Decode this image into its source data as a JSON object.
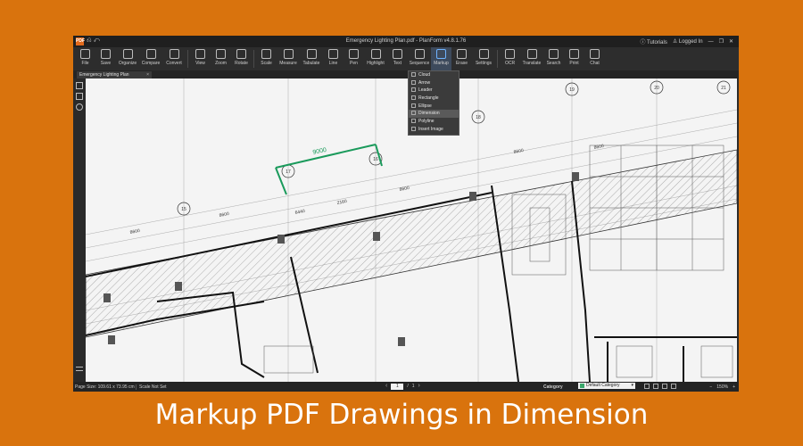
{
  "titlebar": {
    "logo": "PDF",
    "title": "Emergency Lighting Plan.pdf - PlanForm v4.8.1.76",
    "tutorials": "Tutorials",
    "logged_in": "Logged In"
  },
  "toolbar": {
    "items": [
      {
        "label": "File",
        "icon": "folder-icon"
      },
      {
        "label": "Save",
        "icon": "save-icon"
      },
      {
        "label": "Organize",
        "icon": "organize-icon"
      },
      {
        "label": "Compare",
        "icon": "compare-icon"
      },
      {
        "label": "Convert",
        "icon": "convert-icon"
      },
      {
        "label": "View",
        "icon": "view-icon"
      },
      {
        "label": "Zoom",
        "icon": "zoom-icon"
      },
      {
        "label": "Rotate",
        "icon": "rotate-icon"
      },
      {
        "label": "Scale",
        "icon": "scale-icon"
      },
      {
        "label": "Measure",
        "icon": "measure-icon"
      },
      {
        "label": "Tabulate",
        "icon": "tabulate-icon"
      },
      {
        "label": "Line",
        "icon": "line-icon"
      },
      {
        "label": "Pen",
        "icon": "pen-icon"
      },
      {
        "label": "Highlight",
        "icon": "highlight-icon"
      },
      {
        "label": "Text",
        "icon": "text-icon"
      },
      {
        "label": "Sequence",
        "icon": "sequence-icon"
      },
      {
        "label": "Markup",
        "icon": "markup-icon"
      },
      {
        "label": "Erase",
        "icon": "eraser-icon"
      },
      {
        "label": "Settings",
        "icon": "settings-icon"
      },
      {
        "label": "OCR",
        "icon": "ocr-icon"
      },
      {
        "label": "Translate",
        "icon": "translate-icon"
      },
      {
        "label": "Search",
        "icon": "search-icon"
      },
      {
        "label": "Print",
        "icon": "print-icon"
      },
      {
        "label": "Chat",
        "icon": "chat-icon"
      }
    ]
  },
  "markup_menu": {
    "items": [
      {
        "label": "Cloud"
      },
      {
        "label": "Arrow"
      },
      {
        "label": "Leader"
      },
      {
        "label": "Rectangle"
      },
      {
        "label": "Ellipse"
      },
      {
        "label": "Dimension"
      },
      {
        "label": "Polyline"
      },
      {
        "label": "Insert Image"
      }
    ],
    "selected": "Dimension"
  },
  "tab": {
    "title": "Emergency Lighting Plan",
    "close": "×"
  },
  "drawing": {
    "dimension_value": "9000",
    "labels": [
      "8600",
      "8600",
      "6440",
      "2160",
      "8600",
      "8600",
      "8600"
    ],
    "grid_markers": [
      "15",
      "17",
      "16",
      "18",
      "19",
      "20",
      "21"
    ],
    "dimension_color": "#1a9a5b"
  },
  "status": {
    "page_size": "Page Size: 109.61 x 73.95 cm",
    "scale": "Scale Not Set",
    "page_current": "1",
    "page_sep": "/",
    "page_total": "1",
    "category_label": "Category",
    "category_value": "Default Category",
    "zoom": "150%"
  },
  "caption": "Markup PDF Drawings in Dimension",
  "colors": {
    "background": "#d9730d",
    "app_dark": "#2b2b2b",
    "accent": "#6fb3ff"
  }
}
